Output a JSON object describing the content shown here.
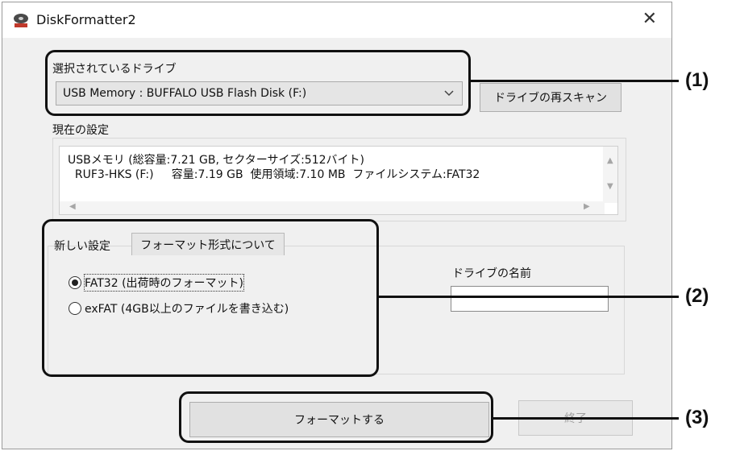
{
  "window": {
    "title": "DiskFormatter2"
  },
  "drive_section": {
    "label": "選択されているドライブ",
    "selected_drive": "USB Memory : BUFFALO  USB Flash Disk   (F:)",
    "rescan_button": "ドライブの再スキャン"
  },
  "current_settings": {
    "label": "現在の設定",
    "line1": "USBメモリ (総容量:7.21 GB, セクターサイズ:512バイト)",
    "line2": "  RUF3-HKS (F:)     容量:7.19 GB  使用領域:7.10 MB  ファイルシステム:FAT32"
  },
  "new_settings": {
    "tab_active": "新しい設定",
    "tab_inactive": "フォーマット形式について",
    "options": [
      {
        "label": "FAT32 (出荷時のフォーマット)",
        "checked": true
      },
      {
        "label": "exFAT (4GB以上のファイルを書き込む)",
        "checked": false
      }
    ],
    "drive_name_label": "ドライブの名前",
    "drive_name_value": ""
  },
  "buttons": {
    "format": "フォーマットする",
    "exit": "終了"
  },
  "annotations": [
    "(1)",
    "(2)",
    "(3)"
  ],
  "icons": {
    "close": "close-icon",
    "app": "disk-app-icon",
    "dropdown": "chevron-down-icon"
  }
}
